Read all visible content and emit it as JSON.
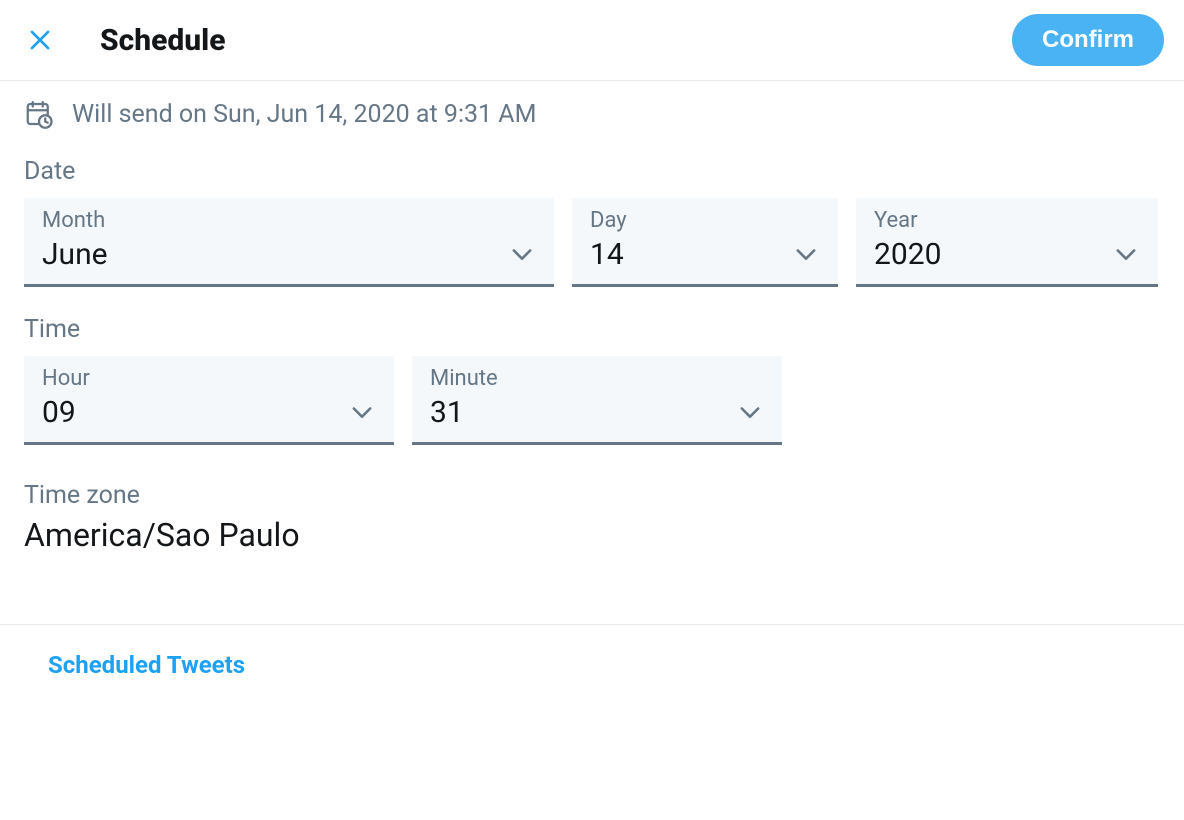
{
  "header": {
    "title": "Schedule",
    "confirm_label": "Confirm"
  },
  "status": {
    "text": "Will send on Sun, Jun 14, 2020 at 9:31 AM"
  },
  "date_section": {
    "label": "Date",
    "month": {
      "label": "Month",
      "value": "June"
    },
    "day": {
      "label": "Day",
      "value": "14"
    },
    "year": {
      "label": "Year",
      "value": "2020"
    }
  },
  "time_section": {
    "label": "Time",
    "hour": {
      "label": "Hour",
      "value": "09"
    },
    "minute": {
      "label": "Minute",
      "value": "31"
    }
  },
  "timezone": {
    "label": "Time zone",
    "value": "America/Sao Paulo"
  },
  "footer": {
    "scheduled_tweets_label": "Scheduled Tweets"
  }
}
